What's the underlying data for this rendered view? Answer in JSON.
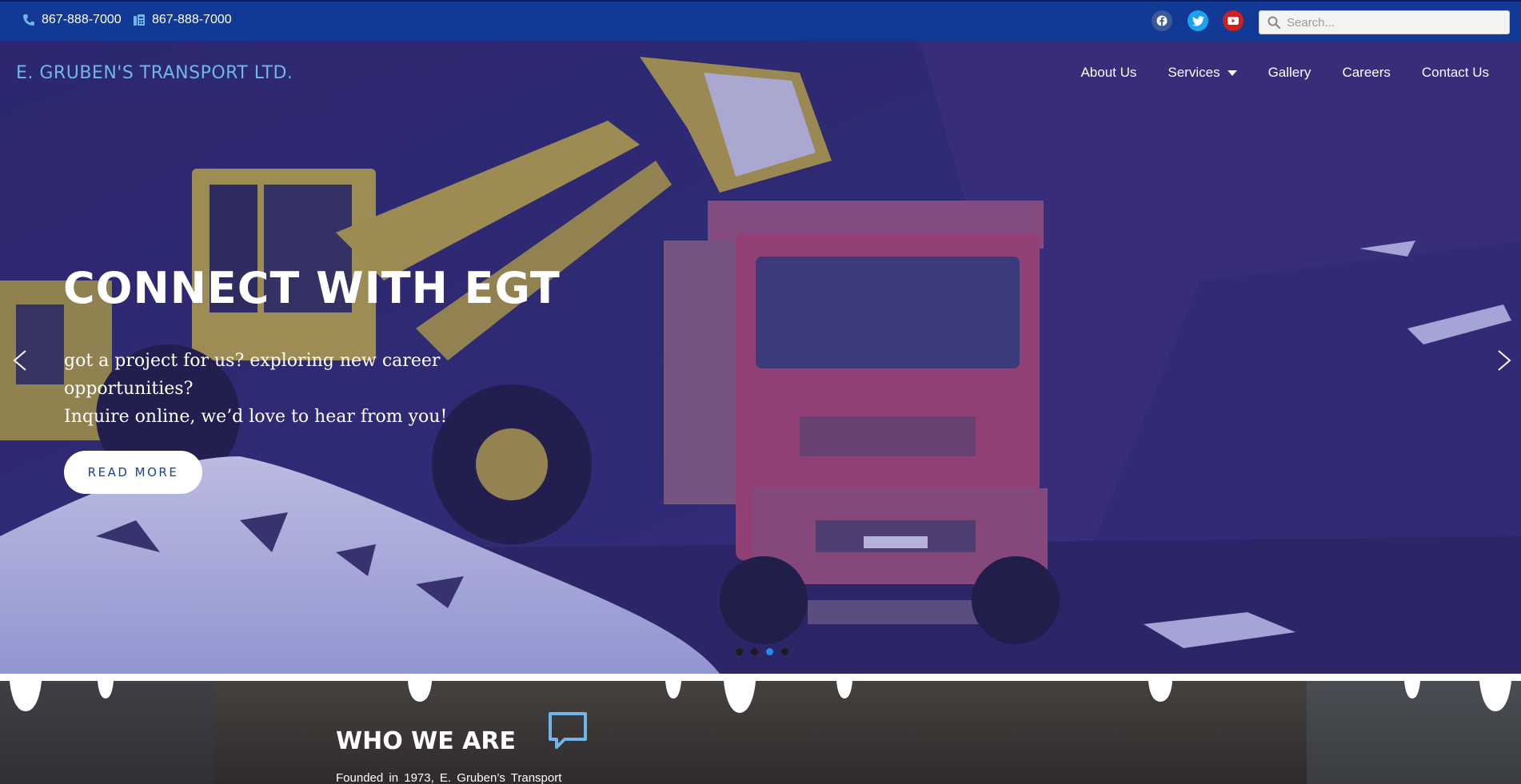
{
  "topbar": {
    "phone1": "867-888-7000",
    "phone2": "867-888-7000",
    "phone_icon": "phone-icon",
    "fax_icon": "fax-icon",
    "social": [
      {
        "name": "facebook-icon",
        "color": "#3b5998"
      },
      {
        "name": "twitter-icon",
        "color": "#1da1f2"
      },
      {
        "name": "youtube-icon",
        "color": "#cd201f"
      }
    ],
    "search": {
      "placeholder": "Search...",
      "value": ""
    }
  },
  "header": {
    "brand": "E. GRUBEN'S TRANSPORT LTD.",
    "nav": [
      {
        "label": "About Us"
      },
      {
        "label": "Services",
        "has_dropdown": true
      },
      {
        "label": "Gallery"
      },
      {
        "label": "Careers"
      },
      {
        "label": "Contact Us"
      }
    ]
  },
  "hero": {
    "headline": "CONNECT WITH EGT",
    "line1": "got a project for us? exploring new career opportunities?",
    "line2": "Inquire online, we’d love to hear from you!",
    "button": "READ MORE",
    "slides": 4,
    "active_slide": 3
  },
  "about": {
    "title": "WHO WE ARE",
    "text": "Founded in 1973, E. Gruben’s Transport"
  },
  "colors": {
    "topbar": "#133996",
    "brand": "#6fb6ea",
    "accent": "#1e8ee6"
  }
}
